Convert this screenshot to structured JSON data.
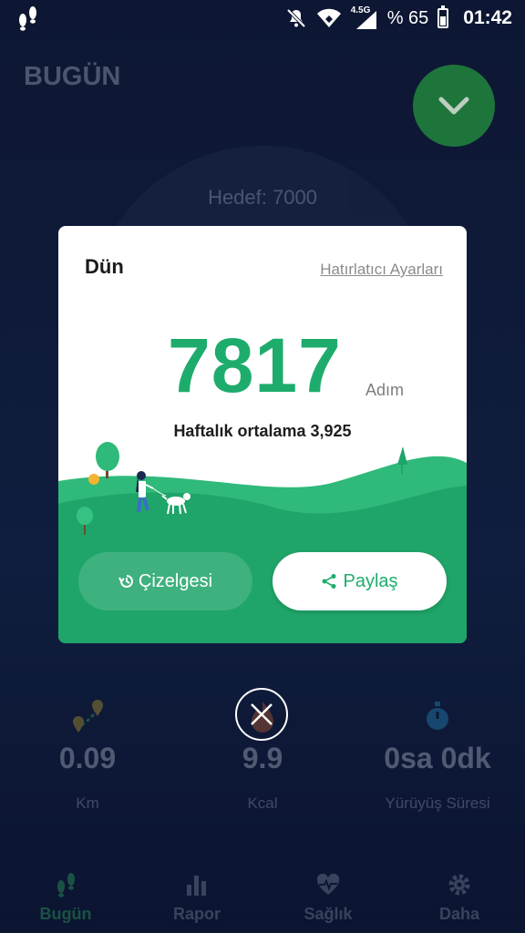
{
  "status_bar": {
    "app_icon": "footsteps-icon",
    "network": "4.5G",
    "battery_text": "% 65",
    "time": "01:42"
  },
  "background": {
    "page_title": "BUGÜN",
    "target_text": "Hedef: 7000",
    "stats": [
      {
        "value": "0.09",
        "label": "Km",
        "icon": "route-pin-icon"
      },
      {
        "value": "9.9",
        "label": "Kcal",
        "icon": "flame-icon"
      },
      {
        "value": "0sa 0dk",
        "label": "Yürüyüş Süresi",
        "icon": "stopwatch-icon"
      }
    ],
    "nav": [
      {
        "label": "Bugün",
        "icon": "footsteps-icon",
        "active": true
      },
      {
        "label": "Rapor",
        "icon": "bar-chart-icon",
        "active": false
      },
      {
        "label": "Sağlık",
        "icon": "heart-pulse-icon",
        "active": false
      },
      {
        "label": "Daha",
        "icon": "gear-icon",
        "active": false
      }
    ]
  },
  "dialog": {
    "title": "Dün",
    "reminder_link": "Hatırlatıcı Ayarları",
    "steps": "7817",
    "unit": "Adım",
    "weekly_avg": "Haftalık ortalama 3,925",
    "chart_button": "Çizelgesi",
    "share_button": "Paylaş"
  },
  "colors": {
    "accent_green": "#1eac6d",
    "background": "#0c1631",
    "active_nav": "#3bd36b"
  }
}
